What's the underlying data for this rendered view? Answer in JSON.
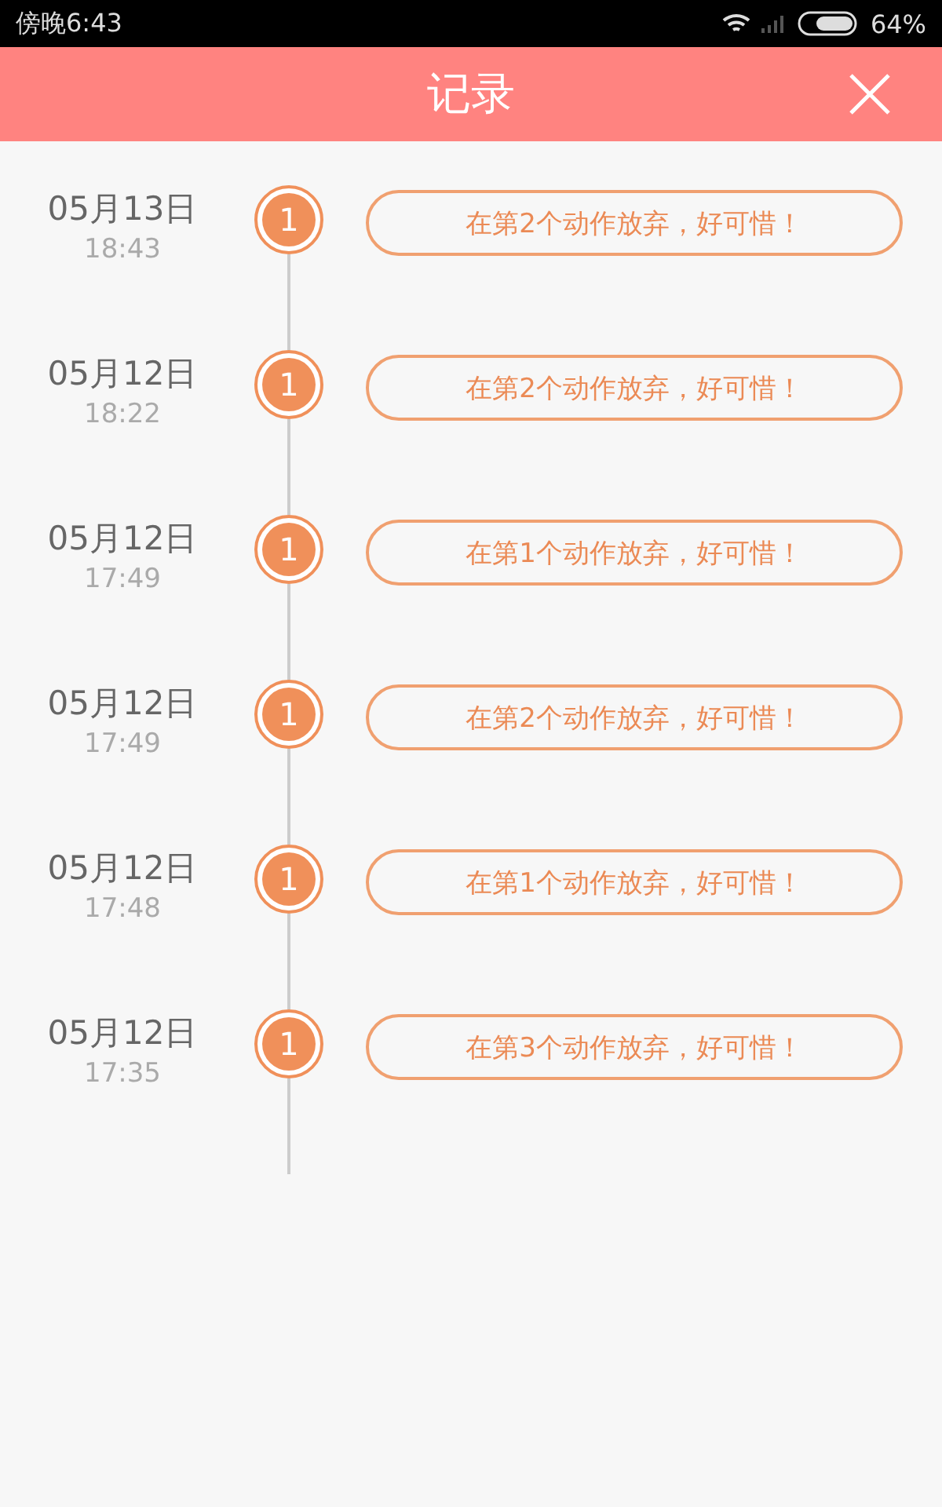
{
  "status_bar": {
    "time": "傍晚6:43",
    "battery": "64%"
  },
  "header": {
    "title": "记录"
  },
  "records": [
    {
      "date": "05月13日",
      "time": "18:43",
      "badge": "1",
      "message": "在第2个动作放弃，好可惜！"
    },
    {
      "date": "05月12日",
      "time": "18:22",
      "badge": "1",
      "message": "在第2个动作放弃，好可惜！"
    },
    {
      "date": "05月12日",
      "time": "17:49",
      "badge": "1",
      "message": "在第1个动作放弃，好可惜！"
    },
    {
      "date": "05月12日",
      "time": "17:49",
      "badge": "1",
      "message": "在第2个动作放弃，好可惜！"
    },
    {
      "date": "05月12日",
      "time": "17:48",
      "badge": "1",
      "message": "在第1个动作放弃，好可惜！"
    },
    {
      "date": "05月12日",
      "time": "17:35",
      "badge": "1",
      "message": "在第3个动作放弃，好可惜！"
    }
  ]
}
